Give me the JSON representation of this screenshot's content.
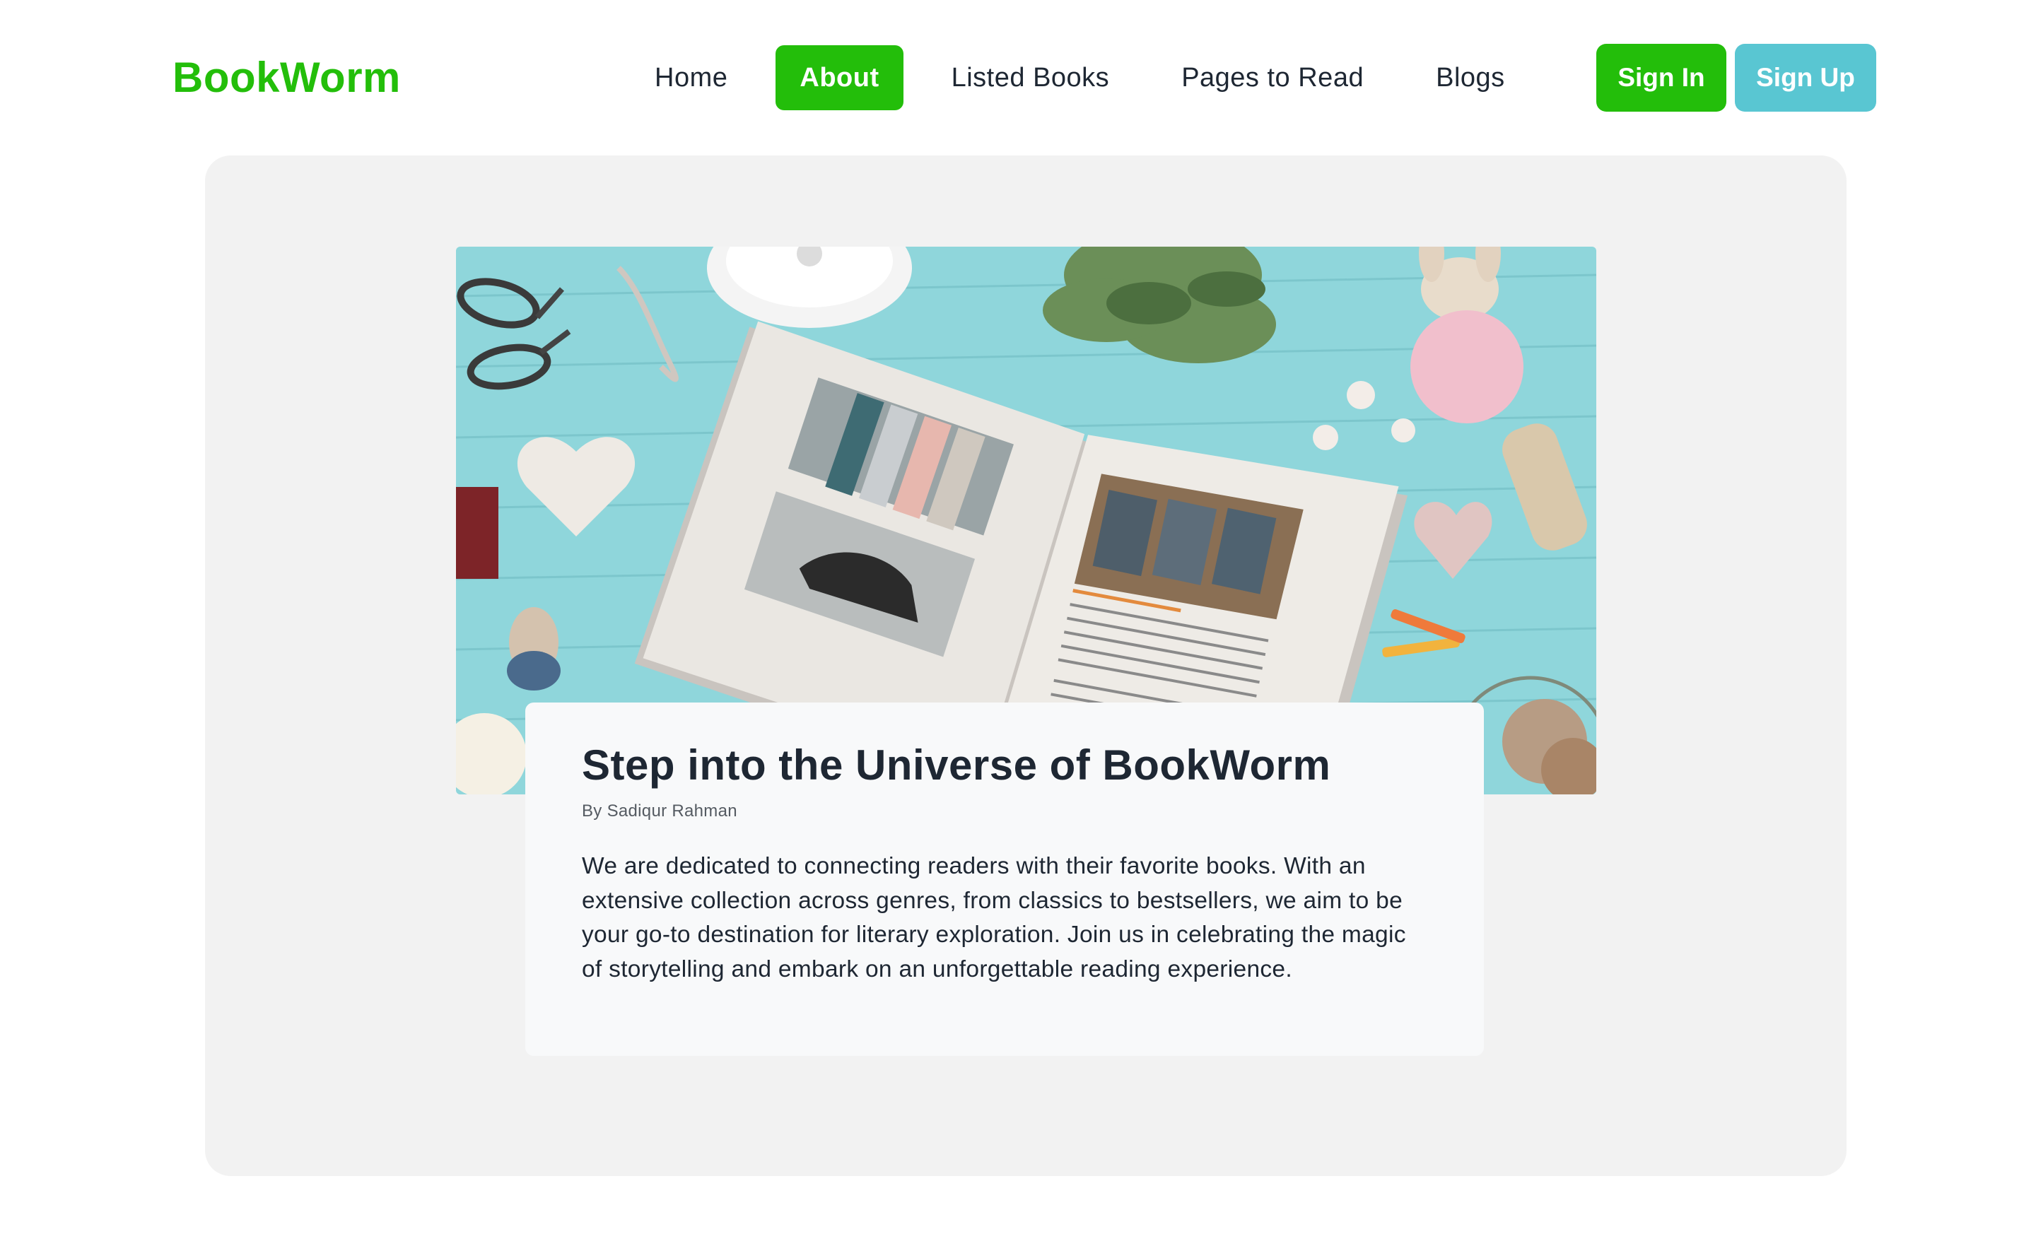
{
  "brand": {
    "name": "BookWorm",
    "color": "#23be0a"
  },
  "nav": {
    "items": [
      {
        "label": "Home",
        "active": false
      },
      {
        "label": "About",
        "active": true
      },
      {
        "label": "Listed Books",
        "active": false
      },
      {
        "label": "Pages to Read",
        "active": false
      },
      {
        "label": "Blogs",
        "active": false
      }
    ]
  },
  "auth": {
    "sign_in_label": "Sign In",
    "sign_up_label": "Sign Up",
    "sign_in_color": "#23be0a",
    "sign_up_color": "#59c6d2"
  },
  "hero": {
    "image_icon": "open-book-craft-photo",
    "title": "Step into the Universe of BookWorm",
    "author": "By Sadiqur Rahman",
    "body": "We are dedicated to connecting readers with their favorite books. With an extensive collection across genres, from classics to bestsellers, we aim to be your go-to destination for literary exploration. Join us in celebrating the magic of storytelling and embark on an unforgettable reading experience."
  }
}
